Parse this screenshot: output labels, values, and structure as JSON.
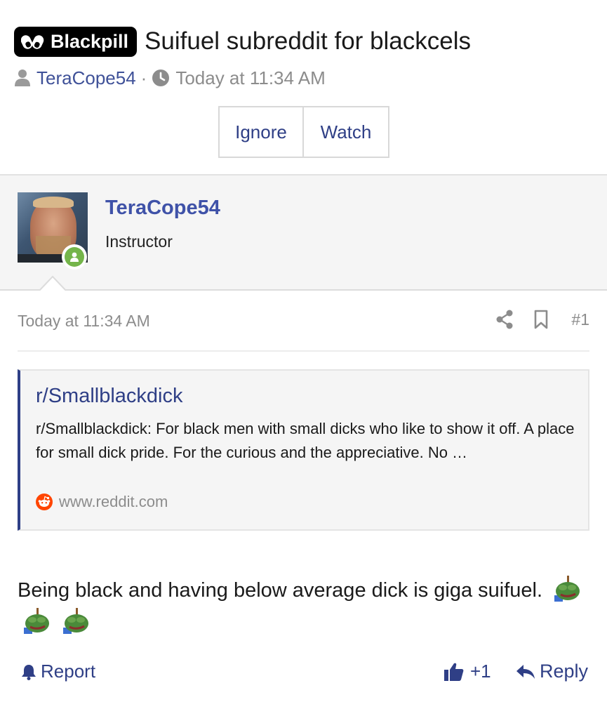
{
  "thread": {
    "prefix": "Blackpill",
    "title": "Suifuel subreddit for blackcels",
    "author": "TeraCope54",
    "separator": "·",
    "date": "Today at 11:34 AM",
    "buttons": {
      "ignore": "Ignore",
      "watch": "Watch"
    }
  },
  "post": {
    "user": {
      "name": "TeraCope54",
      "title": "Instructor",
      "online": true
    },
    "date": "Today at 11:34 AM",
    "number": "#1",
    "embed": {
      "title": "r/Smallblackdick",
      "description": "r/Smallblackdick: For black men with small dicks who like to show it off. A place for small dick pride. For the curious and the appreciative. No …",
      "source": "www.reddit.com"
    },
    "body": "Being black and having below average dick is giga suifuel.",
    "emoji_count": 3,
    "footer": {
      "report": "Report",
      "likes": "+1",
      "reply": "Reply"
    }
  },
  "colors": {
    "link": "#3f5198",
    "button_text": "#2f3f86",
    "muted": "#8c8c8c",
    "online": "#74b54a",
    "reddit": "#ff4500",
    "user_bar_bg": "#f5f5f5"
  },
  "icons": [
    "pill-icon",
    "user-icon",
    "clock-icon",
    "share-icon",
    "bookmark-icon",
    "reddit-icon",
    "pepe-emoji",
    "bell-icon",
    "thumbs-up-icon",
    "reply-icon"
  ]
}
